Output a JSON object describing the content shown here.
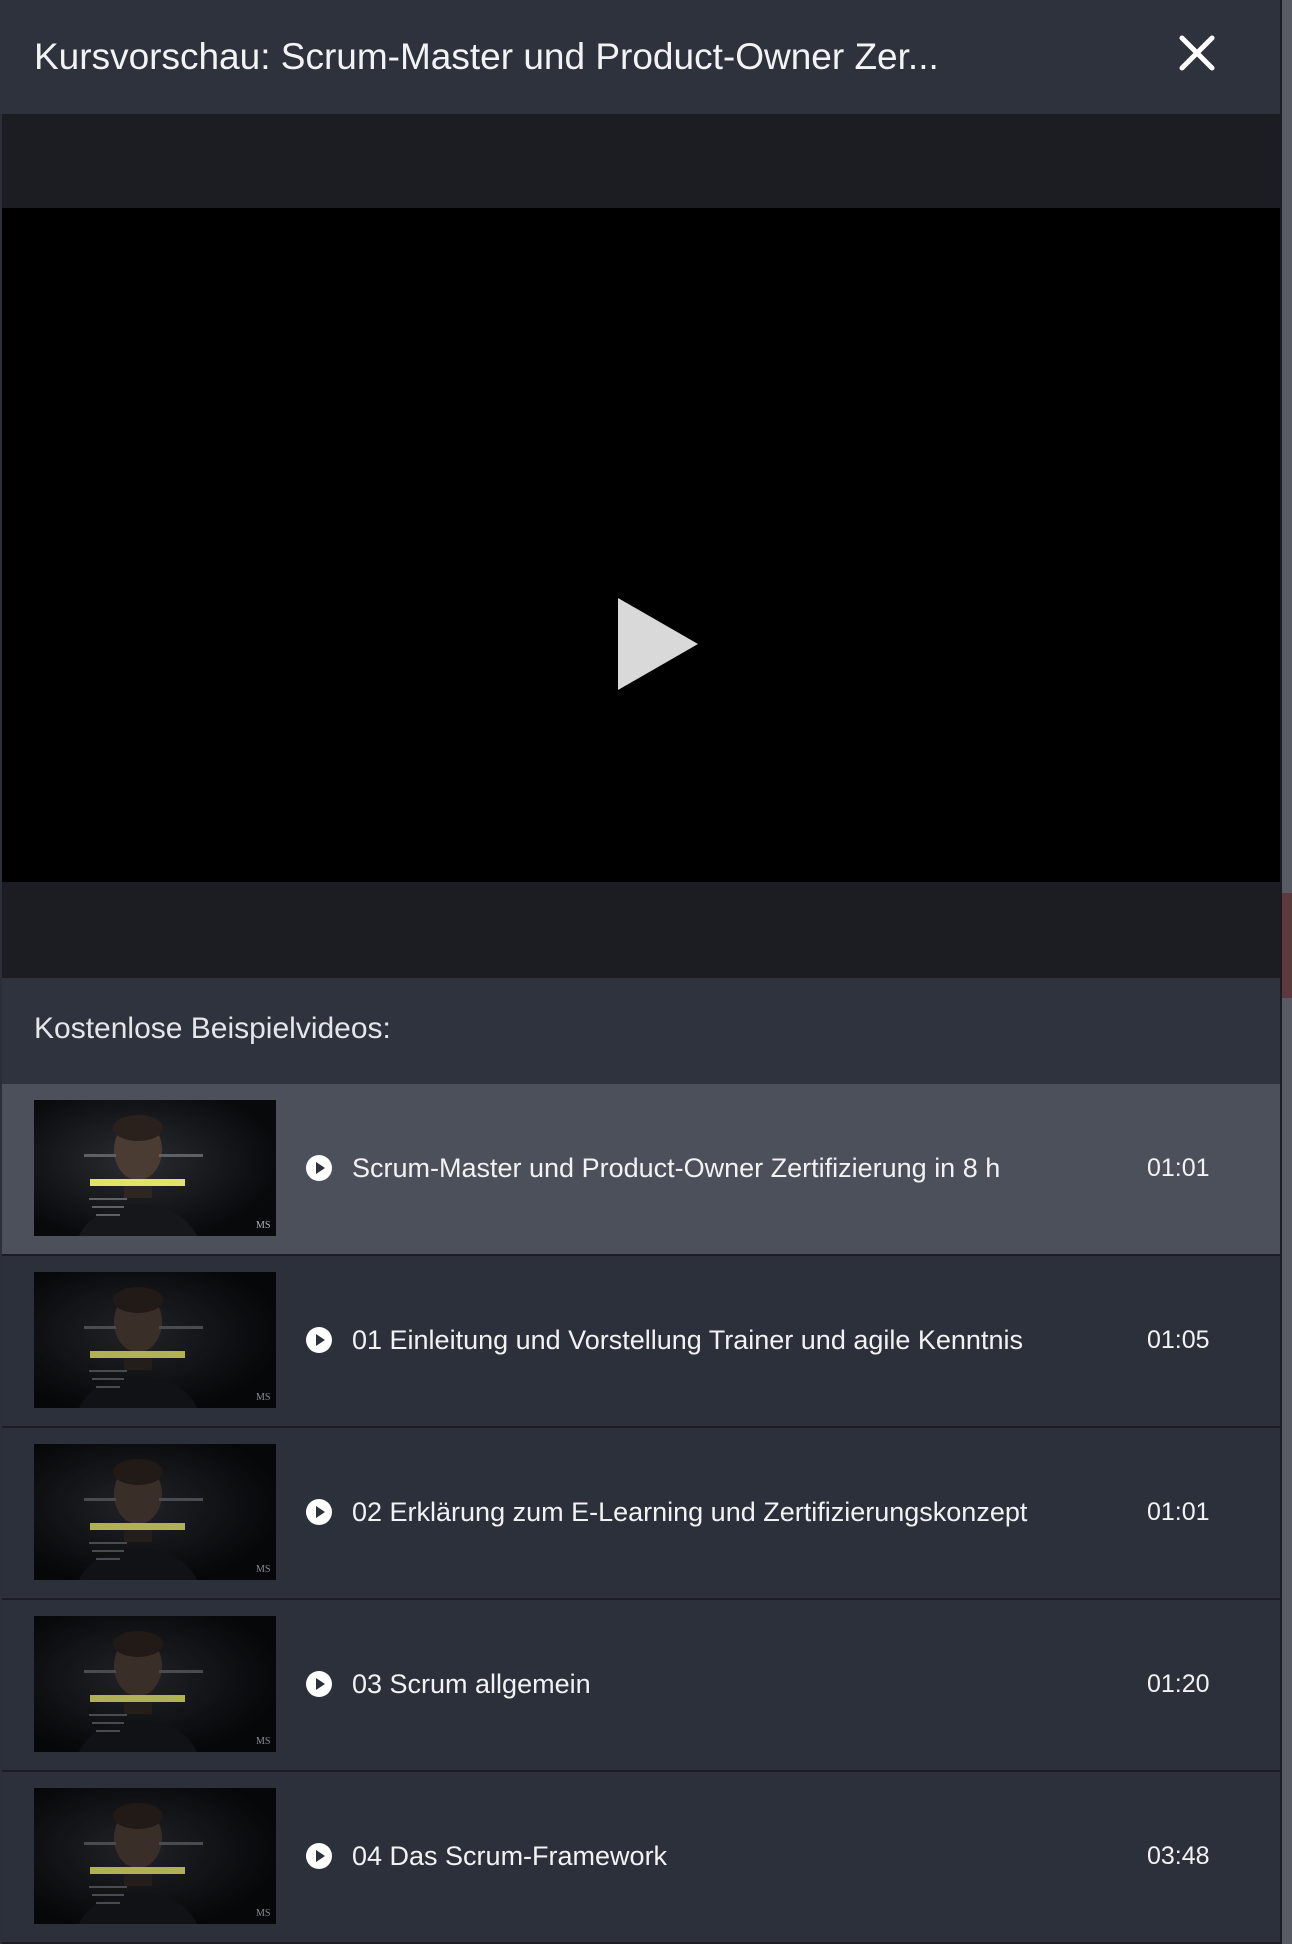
{
  "modal": {
    "title": "Kursvorschau: Scrum-Master und Product-Owner Zer...",
    "close_icon": "close-icon"
  },
  "player": {
    "play_icon": "play-icon"
  },
  "section": {
    "title": "Kostenlose Beispielvideos:"
  },
  "thumbnail": {
    "logo_text": "MS"
  },
  "videos": [
    {
      "title": "Scrum-Master und Product-Owner Zertifizierung in 8 h",
      "duration": "01:01",
      "active": true
    },
    {
      "title": "01 Einleitung und Vorstellung Trainer und agile Kenntnis",
      "duration": "01:05",
      "active": false
    },
    {
      "title": "02 Erklärung zum E-Learning und Zertifizierungskonzept",
      "duration": "01:01",
      "active": false
    },
    {
      "title": "03 Scrum allgemein",
      "duration": "01:20",
      "active": false
    },
    {
      "title": "04 Das Scrum-Framework",
      "duration": "03:48",
      "active": false
    }
  ],
  "colors": {
    "modal_bg": "#2b2f3a",
    "active_row": "#4c505b",
    "thumbnail_accent": "#e0e36a",
    "text": "#f1f2f4"
  }
}
